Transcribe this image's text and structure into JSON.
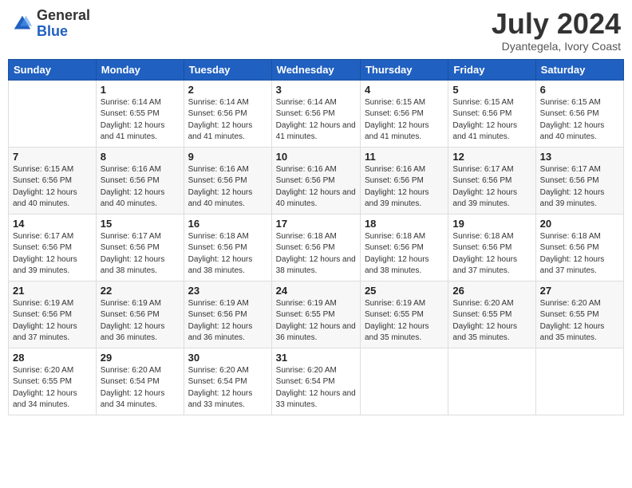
{
  "header": {
    "logo_line1": "General",
    "logo_line2": "Blue",
    "month_year": "July 2024",
    "location": "Dyantegela, Ivory Coast"
  },
  "weekdays": [
    "Sunday",
    "Monday",
    "Tuesday",
    "Wednesday",
    "Thursday",
    "Friday",
    "Saturday"
  ],
  "weeks": [
    [
      {
        "day": "",
        "sunrise": "",
        "sunset": "",
        "daylight": ""
      },
      {
        "day": "1",
        "sunrise": "Sunrise: 6:14 AM",
        "sunset": "Sunset: 6:55 PM",
        "daylight": "Daylight: 12 hours and 41 minutes."
      },
      {
        "day": "2",
        "sunrise": "Sunrise: 6:14 AM",
        "sunset": "Sunset: 6:56 PM",
        "daylight": "Daylight: 12 hours and 41 minutes."
      },
      {
        "day": "3",
        "sunrise": "Sunrise: 6:14 AM",
        "sunset": "Sunset: 6:56 PM",
        "daylight": "Daylight: 12 hours and 41 minutes."
      },
      {
        "day": "4",
        "sunrise": "Sunrise: 6:15 AM",
        "sunset": "Sunset: 6:56 PM",
        "daylight": "Daylight: 12 hours and 41 minutes."
      },
      {
        "day": "5",
        "sunrise": "Sunrise: 6:15 AM",
        "sunset": "Sunset: 6:56 PM",
        "daylight": "Daylight: 12 hours and 41 minutes."
      },
      {
        "day": "6",
        "sunrise": "Sunrise: 6:15 AM",
        "sunset": "Sunset: 6:56 PM",
        "daylight": "Daylight: 12 hours and 40 minutes."
      }
    ],
    [
      {
        "day": "7",
        "sunrise": "Sunrise: 6:15 AM",
        "sunset": "Sunset: 6:56 PM",
        "daylight": "Daylight: 12 hours and 40 minutes."
      },
      {
        "day": "8",
        "sunrise": "Sunrise: 6:16 AM",
        "sunset": "Sunset: 6:56 PM",
        "daylight": "Daylight: 12 hours and 40 minutes."
      },
      {
        "day": "9",
        "sunrise": "Sunrise: 6:16 AM",
        "sunset": "Sunset: 6:56 PM",
        "daylight": "Daylight: 12 hours and 40 minutes."
      },
      {
        "day": "10",
        "sunrise": "Sunrise: 6:16 AM",
        "sunset": "Sunset: 6:56 PM",
        "daylight": "Daylight: 12 hours and 40 minutes."
      },
      {
        "day": "11",
        "sunrise": "Sunrise: 6:16 AM",
        "sunset": "Sunset: 6:56 PM",
        "daylight": "Daylight: 12 hours and 39 minutes."
      },
      {
        "day": "12",
        "sunrise": "Sunrise: 6:17 AM",
        "sunset": "Sunset: 6:56 PM",
        "daylight": "Daylight: 12 hours and 39 minutes."
      },
      {
        "day": "13",
        "sunrise": "Sunrise: 6:17 AM",
        "sunset": "Sunset: 6:56 PM",
        "daylight": "Daylight: 12 hours and 39 minutes."
      }
    ],
    [
      {
        "day": "14",
        "sunrise": "Sunrise: 6:17 AM",
        "sunset": "Sunset: 6:56 PM",
        "daylight": "Daylight: 12 hours and 39 minutes."
      },
      {
        "day": "15",
        "sunrise": "Sunrise: 6:17 AM",
        "sunset": "Sunset: 6:56 PM",
        "daylight": "Daylight: 12 hours and 38 minutes."
      },
      {
        "day": "16",
        "sunrise": "Sunrise: 6:18 AM",
        "sunset": "Sunset: 6:56 PM",
        "daylight": "Daylight: 12 hours and 38 minutes."
      },
      {
        "day": "17",
        "sunrise": "Sunrise: 6:18 AM",
        "sunset": "Sunset: 6:56 PM",
        "daylight": "Daylight: 12 hours and 38 minutes."
      },
      {
        "day": "18",
        "sunrise": "Sunrise: 6:18 AM",
        "sunset": "Sunset: 6:56 PM",
        "daylight": "Daylight: 12 hours and 38 minutes."
      },
      {
        "day": "19",
        "sunrise": "Sunrise: 6:18 AM",
        "sunset": "Sunset: 6:56 PM",
        "daylight": "Daylight: 12 hours and 37 minutes."
      },
      {
        "day": "20",
        "sunrise": "Sunrise: 6:18 AM",
        "sunset": "Sunset: 6:56 PM",
        "daylight": "Daylight: 12 hours and 37 minutes."
      }
    ],
    [
      {
        "day": "21",
        "sunrise": "Sunrise: 6:19 AM",
        "sunset": "Sunset: 6:56 PM",
        "daylight": "Daylight: 12 hours and 37 minutes."
      },
      {
        "day": "22",
        "sunrise": "Sunrise: 6:19 AM",
        "sunset": "Sunset: 6:56 PM",
        "daylight": "Daylight: 12 hours and 36 minutes."
      },
      {
        "day": "23",
        "sunrise": "Sunrise: 6:19 AM",
        "sunset": "Sunset: 6:56 PM",
        "daylight": "Daylight: 12 hours and 36 minutes."
      },
      {
        "day": "24",
        "sunrise": "Sunrise: 6:19 AM",
        "sunset": "Sunset: 6:55 PM",
        "daylight": "Daylight: 12 hours and 36 minutes."
      },
      {
        "day": "25",
        "sunrise": "Sunrise: 6:19 AM",
        "sunset": "Sunset: 6:55 PM",
        "daylight": "Daylight: 12 hours and 35 minutes."
      },
      {
        "day": "26",
        "sunrise": "Sunrise: 6:20 AM",
        "sunset": "Sunset: 6:55 PM",
        "daylight": "Daylight: 12 hours and 35 minutes."
      },
      {
        "day": "27",
        "sunrise": "Sunrise: 6:20 AM",
        "sunset": "Sunset: 6:55 PM",
        "daylight": "Daylight: 12 hours and 35 minutes."
      }
    ],
    [
      {
        "day": "28",
        "sunrise": "Sunrise: 6:20 AM",
        "sunset": "Sunset: 6:55 PM",
        "daylight": "Daylight: 12 hours and 34 minutes."
      },
      {
        "day": "29",
        "sunrise": "Sunrise: 6:20 AM",
        "sunset": "Sunset: 6:54 PM",
        "daylight": "Daylight: 12 hours and 34 minutes."
      },
      {
        "day": "30",
        "sunrise": "Sunrise: 6:20 AM",
        "sunset": "Sunset: 6:54 PM",
        "daylight": "Daylight: 12 hours and 33 minutes."
      },
      {
        "day": "31",
        "sunrise": "Sunrise: 6:20 AM",
        "sunset": "Sunset: 6:54 PM",
        "daylight": "Daylight: 12 hours and 33 minutes."
      },
      {
        "day": "",
        "sunrise": "",
        "sunset": "",
        "daylight": ""
      },
      {
        "day": "",
        "sunrise": "",
        "sunset": "",
        "daylight": ""
      },
      {
        "day": "",
        "sunrise": "",
        "sunset": "",
        "daylight": ""
      }
    ]
  ]
}
